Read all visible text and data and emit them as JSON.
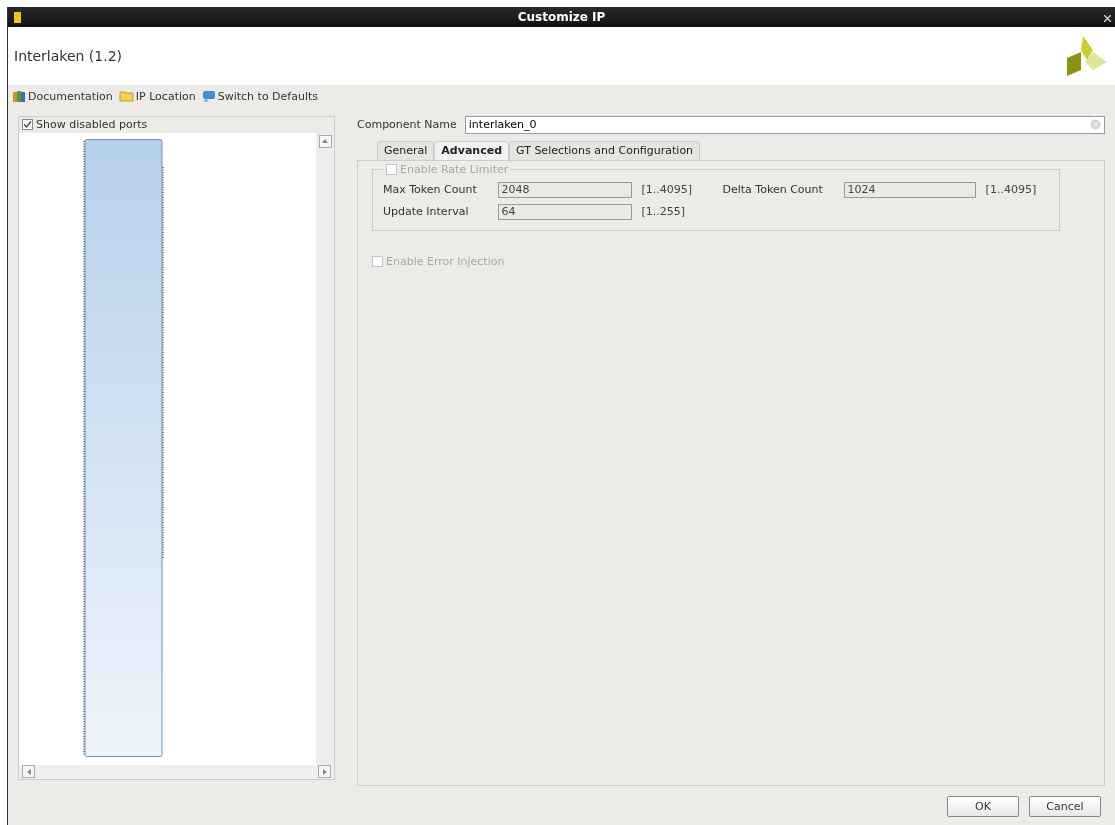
{
  "window": {
    "title": "Customize IP"
  },
  "header": {
    "title": "Interlaken (1.2)"
  },
  "toolbar": [
    {
      "kind": "book",
      "label": "Documentation"
    },
    {
      "kind": "folder",
      "label": "IP Location"
    },
    {
      "kind": "reset",
      "label": "Switch to Defaults"
    }
  ],
  "symbol_panel": {
    "show_disabled_ports": {
      "label": "Show disabled ports",
      "checked": true
    }
  },
  "component_name": {
    "label": "Component Name",
    "value": "interlaken_0"
  },
  "tabs": [
    {
      "label": "General",
      "selected": false
    },
    {
      "label": "Advanced",
      "selected": true
    },
    {
      "label": "GT Selections and Configuration",
      "selected": false
    }
  ],
  "rate_limiter": {
    "label": "Enable Rate Limiter",
    "checked": false,
    "disabled": true,
    "fields": [
      {
        "label": "Max Token Count",
        "value": "2048",
        "range": "[1..4095]"
      },
      {
        "label": "Delta Token Count",
        "value": "1024",
        "range": "[1..4095]"
      },
      {
        "label": "Update Interval",
        "value": "64",
        "range": "[1..255]"
      }
    ]
  },
  "error_injection": {
    "label": "Enable Error Injection",
    "checked": false,
    "disabled": true
  },
  "buttons": [
    "OK",
    "Cancel"
  ]
}
